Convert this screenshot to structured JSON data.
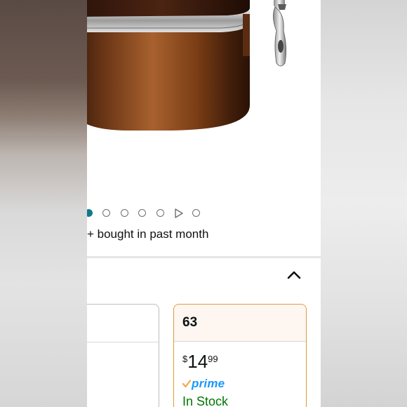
{
  "product": {
    "bought_text": "+ bought in past month",
    "carousel": {
      "image_count": 7,
      "active_index": 0,
      "video_index": 5
    }
  },
  "options": {
    "selected": {
      "label": "63",
      "price_symbol": "$",
      "price_whole": "14",
      "price_fraction": "99",
      "prime_label": "prime",
      "availability": "In Stock"
    }
  },
  "colors": {
    "active_dot": "#0f7a8a",
    "selected_border": "#e39a3c",
    "prime_blue": "#1a98ff",
    "prime_check": "#f3a847",
    "in_stock": "#007600"
  },
  "icons": [
    "chevron-up-icon",
    "play-icon",
    "prime-check-icon"
  ]
}
